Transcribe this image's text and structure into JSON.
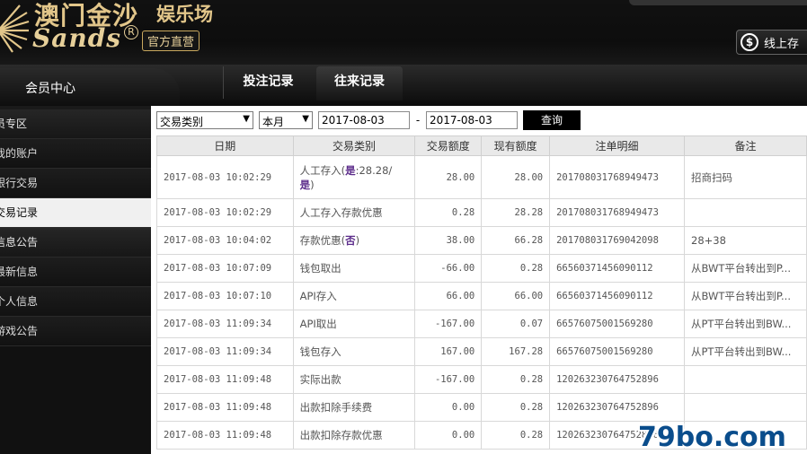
{
  "header": {
    "logo_cn": "澳门金沙",
    "logo_cn2": "娱乐场",
    "logo_en": "Sands",
    "logo_reg": "R",
    "logo_tag": "官方直营",
    "deposit_label": "线上存",
    "dollar_symbol": "$"
  },
  "nav": {
    "member_center": "会员中心",
    "tabs": [
      "投注记录",
      "往来记录"
    ]
  },
  "sidebar": {
    "items": [
      "员专区",
      "我的账户",
      "银行交易",
      "交易记录",
      "信息公告",
      "最新信息",
      "个人信息",
      "游戏公告"
    ]
  },
  "filter": {
    "type_select": "交易类别",
    "period_select": "本月",
    "date_from": "2017-08-03",
    "separator": "-",
    "date_to": "2017-08-03",
    "query_label": "查询"
  },
  "table": {
    "headers": [
      "日期",
      "交易类别",
      "交易额度",
      "现有额度",
      "注单明细",
      "备注"
    ],
    "rows": [
      {
        "date": "2017-08-03 10:02:29",
        "type": "人工存入(",
        "tag": "是",
        "type_suffix": ":28.28/",
        "type_line2_tag": "是",
        "type_line2_suffix": ")",
        "amount": "28.00",
        "balance": "28.00",
        "detail": "201708031768949473",
        "remark": "招商扫码"
      },
      {
        "date": "2017-08-03 10:02:29",
        "type": "人工存入存款优惠",
        "tag": "",
        "type_suffix": "",
        "amount": "0.28",
        "balance": "28.28",
        "detail": "201708031768949473",
        "remark": ""
      },
      {
        "date": "2017-08-03 10:04:02",
        "type": "存款优惠(",
        "tag": "否",
        "type_suffix": ")",
        "amount": "38.00",
        "balance": "66.28",
        "detail": "201708031769042098",
        "remark": "28+38"
      },
      {
        "date": "2017-08-03 10:07:09",
        "type": "钱包取出",
        "tag": "",
        "type_suffix": "",
        "amount": "-66.00",
        "balance": "0.28",
        "detail": "66560371456090112",
        "remark": "从BWT平台转出到P..."
      },
      {
        "date": "2017-08-03 10:07:10",
        "type": "API存入",
        "tag": "",
        "type_suffix": "",
        "amount": "66.00",
        "balance": "66.00",
        "detail": "66560371456090112",
        "remark": "从BWT平台转出到P..."
      },
      {
        "date": "2017-08-03 11:09:34",
        "type": "API取出",
        "tag": "",
        "type_suffix": "",
        "amount": "-167.00",
        "balance": "0.07",
        "detail": "66576075001569280",
        "remark": "从PT平台转出到BW..."
      },
      {
        "date": "2017-08-03 11:09:34",
        "type": "钱包存入",
        "tag": "",
        "type_suffix": "",
        "amount": "167.00",
        "balance": "167.28",
        "detail": "66576075001569280",
        "remark": "从PT平台转出到BW..."
      },
      {
        "date": "2017-08-03 11:09:48",
        "type": "实际出款",
        "tag": "",
        "type_suffix": "",
        "amount": "-167.00",
        "balance": "0.28",
        "detail": "120263230764752896",
        "remark": ""
      },
      {
        "date": "2017-08-03 11:09:48",
        "type": "出款扣除手续费",
        "tag": "",
        "type_suffix": "",
        "amount": "0.00",
        "balance": "0.28",
        "detail": "120263230764752896",
        "remark": ""
      },
      {
        "date": "2017-08-03 11:09:48",
        "type": "出款扣除存款优惠",
        "tag": "",
        "type_suffix": "",
        "amount": "0.00",
        "balance": "0.28",
        "detail": "120263230764752896",
        "remark": ""
      }
    ]
  },
  "watermark": "79bo.com",
  "colors": {
    "gold": "#e2c68a",
    "tag": "#5b2b8a",
    "watermark": "#0a4d8c"
  }
}
